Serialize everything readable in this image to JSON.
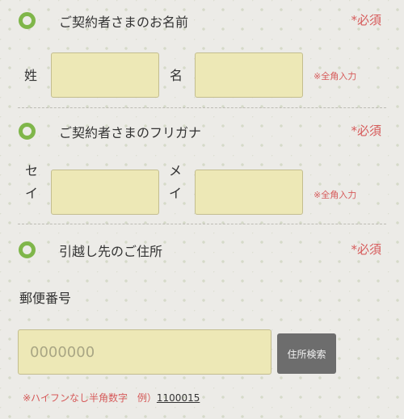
{
  "section1": {
    "title": "ご契約者さまのお名前",
    "required": "*必須",
    "last_label": "姓",
    "first_label": "名",
    "last_value": "",
    "first_value": "",
    "note": "※全角入力"
  },
  "section2": {
    "title": "ご契約者さまのフリガナ",
    "required": "*必須",
    "last_label_line1": "セ",
    "last_label_line2": "イ",
    "first_label_line1": "メ",
    "first_label_line2": "イ",
    "last_value": "",
    "first_value": "",
    "note": "※全角入力"
  },
  "section3": {
    "title": "引越し先のご住所",
    "required": "*必須",
    "postal_label": "郵便番号",
    "postal_placeholder": "0000000",
    "search_button": "住所検索",
    "hint_prefix": "※ハイフンなし半角数字",
    "hint_example_label": "例）",
    "hint_example_value": "1100015"
  },
  "colors": {
    "accent_green": "#7fb64a",
    "required_red": "#d65a5a",
    "input_bg": "#ede8b6",
    "button_gray": "#6d6d6d"
  }
}
